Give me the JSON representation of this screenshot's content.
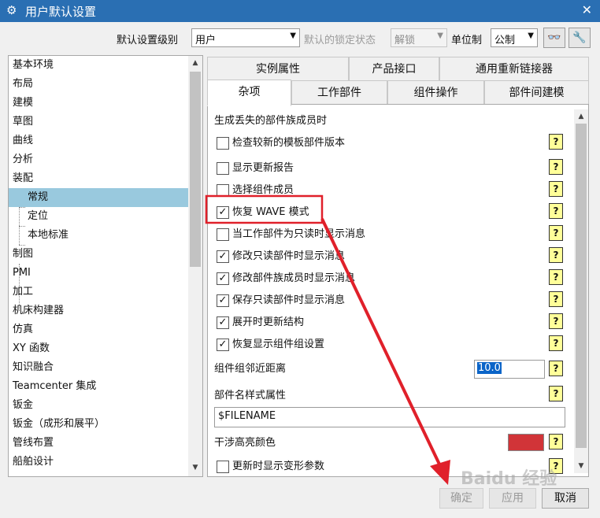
{
  "window": {
    "title": "用户默认设置"
  },
  "top": {
    "level_label": "默认设置级别",
    "level_value": "用户",
    "lock_label": "默认的锁定状态",
    "lock_value": "解锁",
    "unit_label": "单位制",
    "unit_value": "公制"
  },
  "tree": {
    "items": [
      "基本环境",
      "布局",
      "建模",
      "草图",
      "曲线",
      "分析",
      "装配",
      "常规",
      "定位",
      "本地标准",
      "制图",
      "PMI",
      "加工",
      "机床构建器",
      "仿真",
      "XY 函数",
      "知识融合",
      "Teamcenter 集成",
      "钣金",
      "钣金（成形和展平）",
      "管线布置",
      "船舶设计"
    ],
    "selected": "常规"
  },
  "tabs": {
    "row1": [
      "实例属性",
      "产品接口",
      "通用重新链接器"
    ],
    "row2": [
      "杂项",
      "工作部件",
      "组件操作",
      "部件间建模"
    ],
    "active": "杂项"
  },
  "panel": {
    "section_title": "生成丢失的部件族成员时",
    "options": [
      {
        "label": "检查较新的模板部件版本",
        "checked": false
      },
      {
        "label": "显示更新报告",
        "checked": false
      },
      {
        "label": "选择组件成员",
        "checked": false
      },
      {
        "label": "恢复 WAVE 模式",
        "checked": true
      },
      {
        "label": "当工作部件为只读时显示消息",
        "checked": false
      },
      {
        "label": "修改只读部件时显示消息",
        "checked": true
      },
      {
        "label": "修改部件族成员时显示消息",
        "checked": true
      },
      {
        "label": "保存只读部件时显示消息",
        "checked": true
      },
      {
        "label": "展开时更新结构",
        "checked": true
      },
      {
        "label": "恢复显示组件组设置",
        "checked": true
      }
    ],
    "distance_label": "组件组邻近距离",
    "distance_value": "10.0",
    "name_attr_label": "部件名样式属性",
    "name_attr_value": "$FILENAME",
    "color_label": "干涉高亮颜色",
    "color_value": "#d13438",
    "last_option": {
      "label": "更新时显示变形参数",
      "checked": false
    }
  },
  "buttons": {
    "ok": "确定",
    "apply": "应用",
    "cancel": "取消"
  },
  "icons": {
    "settings": "gear-icon",
    "close": "close-icon",
    "binoculars": "binoculars-icon",
    "tool": "tool-icon",
    "help": "help-icon"
  },
  "annotation": {
    "color": "#e0202a"
  },
  "watermark": "Baidu 经验"
}
